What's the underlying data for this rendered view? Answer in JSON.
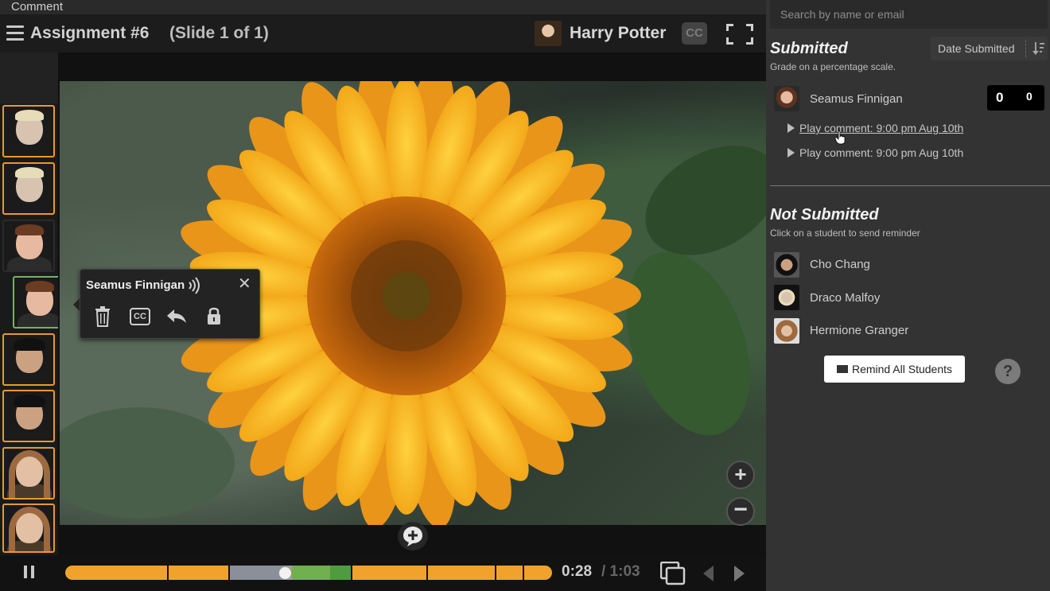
{
  "comment_label": "Comment",
  "header": {
    "title": "Assignment #6",
    "slide_info": "(Slide 1 of 1)",
    "user_name": "Harry Potter",
    "cc_label": "CC"
  },
  "popup": {
    "student_name": "Seamus Finnigan",
    "cc_label": "CC",
    "close_symbol": "✕"
  },
  "playback": {
    "current_time": "0:28",
    "total_time": "/ 1:03",
    "progress": 0.45
  },
  "panel": {
    "search_placeholder": "Search by name or email",
    "submitted": {
      "title": "Submitted",
      "subtitle": "Grade on a percentage scale.",
      "sort_label": "Date Submitted",
      "students": [
        {
          "name": "Seamus Finnigan",
          "grade_left": "0",
          "grade_right": "0"
        }
      ],
      "comments": [
        "Play comment: 9:00 pm Aug 10th",
        "Play comment: 9:00 pm Aug 10th"
      ]
    },
    "not_submitted": {
      "title": "Not Submitted",
      "subtitle": "Click on a student to send reminder",
      "students": [
        {
          "name": "Cho Chang"
        },
        {
          "name": "Draco Malfoy"
        },
        {
          "name": "Hermione Granger"
        }
      ]
    },
    "remind_button": "Remind All Students",
    "help_symbol": "?"
  },
  "colors": {
    "accent_orange": "#f1a22c",
    "accent_green": "#6fb26a",
    "panel_bg": "#333333"
  }
}
